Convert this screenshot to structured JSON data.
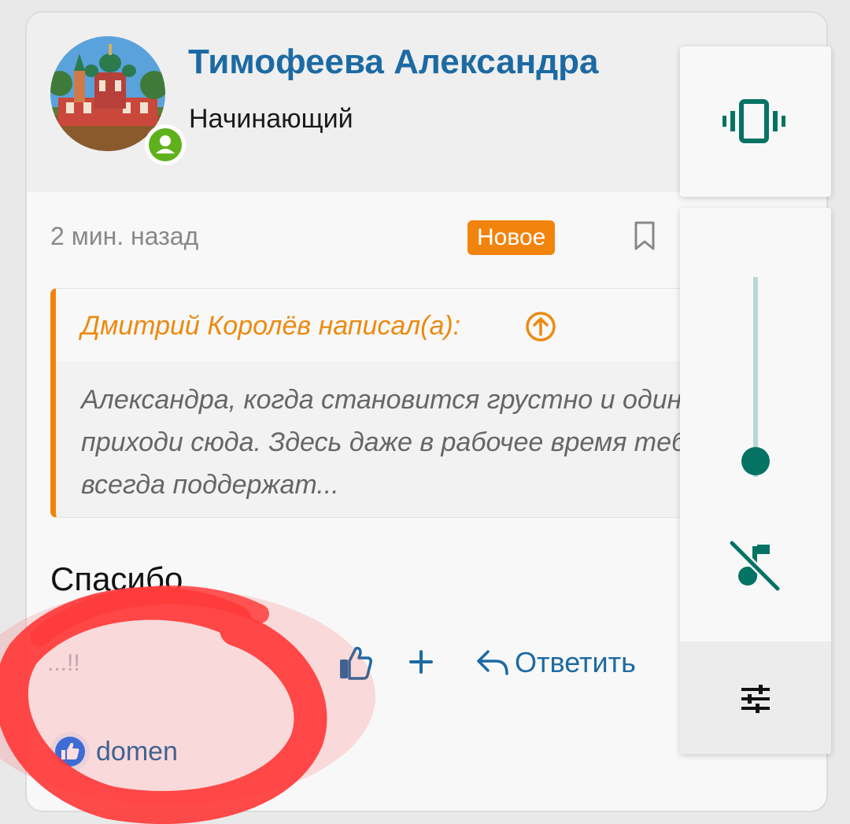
{
  "post": {
    "author_name": "Тимофеева Александра",
    "author_rank": "Начинающий",
    "time": "2 мин. назад",
    "badge": "Новое",
    "quote": {
      "author": "Дмитрий Королёв написал(а):",
      "text": "Александра, когда становится грустно и одиноко, приходи сюда. Здесь даже в рабочее время тебя всегда поддержат..."
    },
    "message": "Спасибо",
    "partial_text": "...!!",
    "actions": {
      "reply_label": "Ответить"
    },
    "reaction": {
      "user": "domen"
    }
  },
  "volume_panel": {
    "level": 0.08
  },
  "colors": {
    "accent_blue": "#1c6aa3",
    "badge_orange": "#f2830d",
    "quote_orange": "#ec8a10",
    "online_green": "#5fb11c",
    "volume_teal": "#057364",
    "annotation_red": "#ff3b3b"
  },
  "icons": [
    "online-status-icon",
    "bookmark-icon",
    "quote-up-arrow-icon",
    "like-icon",
    "plus-icon",
    "reply-icon",
    "reaction-like-icon",
    "vibrate-icon",
    "music-off-icon",
    "tune-icon"
  ]
}
